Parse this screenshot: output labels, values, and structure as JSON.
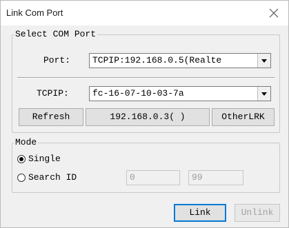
{
  "window": {
    "title": "Link Com Port",
    "close_icon": "close-icon"
  },
  "select_com": {
    "legend": "Select COM Port",
    "port_label": "Port:",
    "port_value": "TCPIP:192.168.0.5(Realte",
    "tcpip_label": "TCPIP:",
    "tcpip_value": "fc-16-07-10-03-7a",
    "refresh_label": "Refresh",
    "ip_button_label": "192.168.0.3( )",
    "other_label": "OtherLRK"
  },
  "mode": {
    "legend": "Mode",
    "single_label": "Single",
    "single_checked": true,
    "search_label": "Search ID",
    "search_checked": false,
    "id_from": "0",
    "id_to": "99"
  },
  "actions": {
    "link_label": "Link",
    "unlink_label": "Unlink"
  },
  "colors": {
    "accent": "#0078d7",
    "window_bg": "#f0f0f0"
  }
}
